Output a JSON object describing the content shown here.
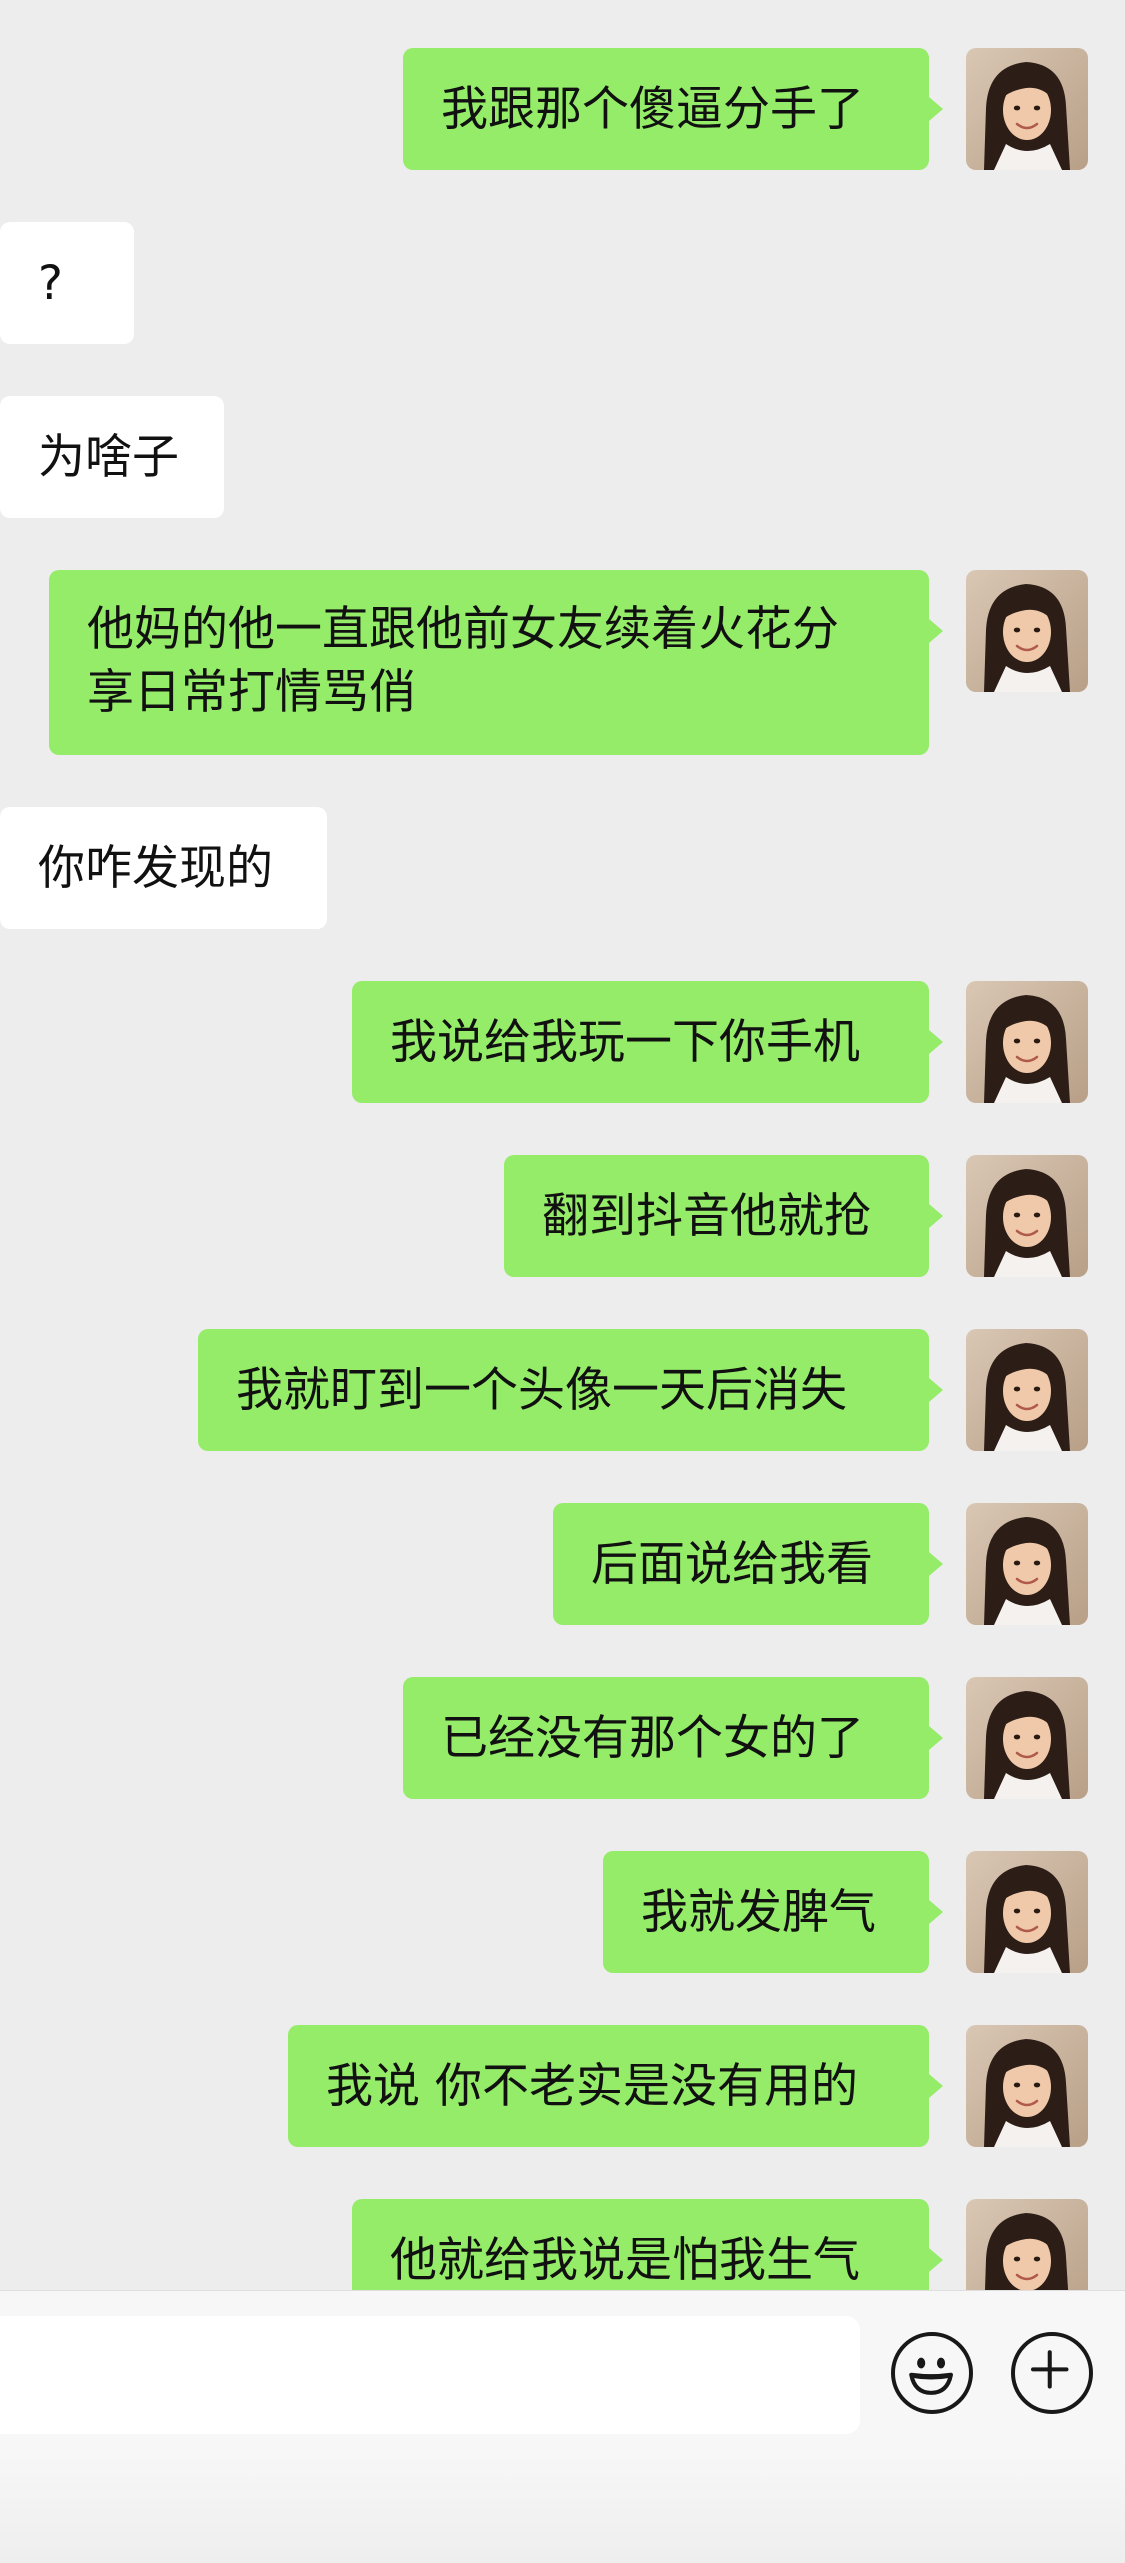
{
  "messages": [
    {
      "from": "self",
      "text": "我跟那个傻逼分手了"
    },
    {
      "from": "other",
      "text": "?"
    },
    {
      "from": "other",
      "text": "为啥子"
    },
    {
      "from": "self",
      "text": "他妈的他一直跟他前女友续着火花分\n享日常打情骂俏"
    },
    {
      "from": "other",
      "text": "你咋发现的"
    },
    {
      "from": "self",
      "text": "我说给我玩一下你手机"
    },
    {
      "from": "self",
      "text": "翻到抖音他就抢"
    },
    {
      "from": "self",
      "text": "我就盯到一个头像一天后消失"
    },
    {
      "from": "self",
      "text": "后面说给我看"
    },
    {
      "from": "self",
      "text": "已经没有那个女的了"
    },
    {
      "from": "self",
      "text": "我就发脾气"
    },
    {
      "from": "self",
      "text": "我说 你不老实是没有用的"
    },
    {
      "from": "self",
      "text": "他就给我说是怕我生气"
    }
  ],
  "input_bar": {
    "emoji_icon": "smiley-face-icon",
    "plus_icon": "plus-circle-icon"
  },
  "colors": {
    "self_bubble": "#95ec69",
    "other_bubble": "#ffffff",
    "background": "#ededed"
  }
}
